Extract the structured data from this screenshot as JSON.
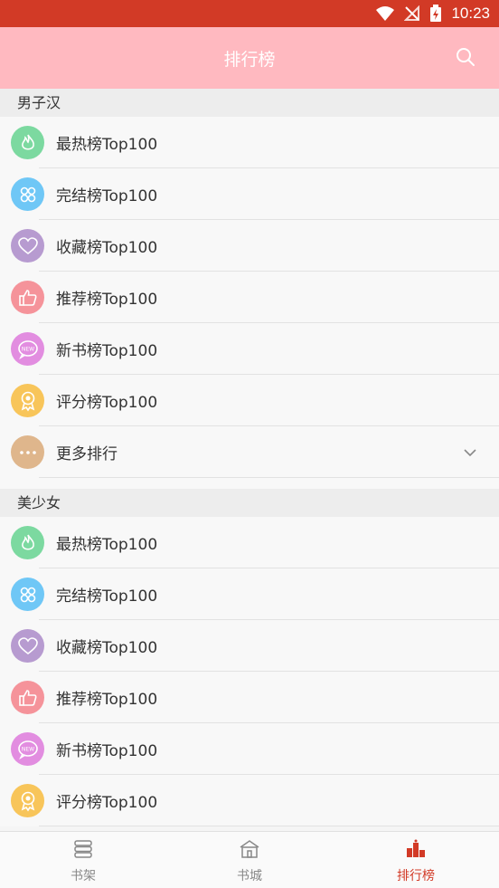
{
  "status_bar": {
    "time": "10:23"
  },
  "header": {
    "title": "排行榜"
  },
  "sections": [
    {
      "title": "男子汉",
      "items": [
        {
          "label": "最热榜Top100",
          "icon": "flame-icon",
          "color": "#7cd9a0"
        },
        {
          "label": "完结榜Top100",
          "icon": "grid-icon",
          "color": "#6fc7f6"
        },
        {
          "label": "收藏榜Top100",
          "icon": "heart-icon",
          "color": "#b79bd0"
        },
        {
          "label": "推荐榜Top100",
          "icon": "thumbs-up-icon",
          "color": "#f5939a"
        },
        {
          "label": "新书榜Top100",
          "icon": "new-badge-icon",
          "color": "#e28de0"
        },
        {
          "label": "评分榜Top100",
          "icon": "medal-icon",
          "color": "#f8c55a"
        },
        {
          "label": "更多排行",
          "icon": "more-icon",
          "color": "#dfb68c"
        }
      ]
    },
    {
      "title": "美少女",
      "items": [
        {
          "label": "最热榜Top100",
          "icon": "flame-icon",
          "color": "#7cd9a0"
        },
        {
          "label": "完结榜Top100",
          "icon": "grid-icon",
          "color": "#6fc7f6"
        },
        {
          "label": "收藏榜Top100",
          "icon": "heart-icon",
          "color": "#b79bd0"
        },
        {
          "label": "推荐榜Top100",
          "icon": "thumbs-up-icon",
          "color": "#f5939a"
        },
        {
          "label": "新书榜Top100",
          "icon": "new-badge-icon",
          "color": "#e28de0"
        },
        {
          "label": "评分榜Top100",
          "icon": "medal-icon",
          "color": "#f8c55a"
        }
      ]
    }
  ],
  "tabs": [
    {
      "label": "书架",
      "icon": "bookshelf-icon",
      "active": false
    },
    {
      "label": "书城",
      "icon": "bookstore-icon",
      "active": false
    },
    {
      "label": "排行榜",
      "icon": "ranking-icon",
      "active": true
    }
  ],
  "colors": {
    "status_bar": "#d23a26",
    "header": "#ffb9c0",
    "active_tab": "#d23a26"
  }
}
